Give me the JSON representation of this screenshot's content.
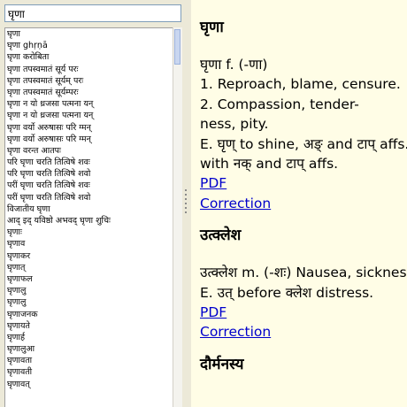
{
  "search": {
    "value": "घृणा"
  },
  "results": [
    "घृणा",
    "घृणा ghṛṇā",
    "घृणा करोबिता",
    "घृणा तपस्वमातं सूर्य परः",
    "घृणा तपस्वमातं सूर्यम् परः",
    "घृणा तपस्वमातं सूर्यम्परः",
    "घृणा न यो ध्रजसा पत्मना यन्",
    "घृणा न यो ध्रजसा पत्मना यन्",
    "घृणा वर्यो अरुषासः परि ग्मन्",
    "घृणा वर्यो अरुषासः परि ग्मन्",
    "घृणा वरन्त आतपः",
    "परि घृणा चरति तित्विषे शवः",
    "परि घृणा चरति तित्विषे शवो",
    "परीं घृणा चरति तित्विषे शवः",
    "परीं घृणा चरति तित्विषे शवो",
    "विजातीय घृणा",
    "आद् इद् यविष्ठो अभवद् घृणा शुचिः",
    "घृणाः",
    "घृणाव",
    "घृणाकर",
    "घृणात्",
    "घृणाफल",
    "घृणालु",
    "घृणालु",
    "घृणाजनक",
    "घृणायते",
    "घृणार्ह",
    "घृणालुआ",
    "घृणावता",
    "घृणावती",
    "घृणावत्"
  ],
  "entries": [
    {
      "headword": "घृणा",
      "lines": [
        "घृणा f. (-णा)",
        "1. Reproach, blame, censure.",
        "2. Compassion, tender-",
        "ness, pity.",
        "E. घृण् to shine, अङ् and टाप् affs.",
        "with नक् and टाप् affs."
      ],
      "links": {
        "pdf": "PDF",
        "correction": "Correction"
      }
    },
    {
      "headword": "उत्क्लेश",
      "lines": [
        "उत्क्लेश m. (-शः) Nausea, sickness.",
        "E. उत् before क्लेश distress."
      ],
      "links": {
        "pdf": "PDF",
        "correction": "Correction"
      }
    },
    {
      "headword": "दौर्मनस्य",
      "lines": [],
      "links": {}
    }
  ]
}
